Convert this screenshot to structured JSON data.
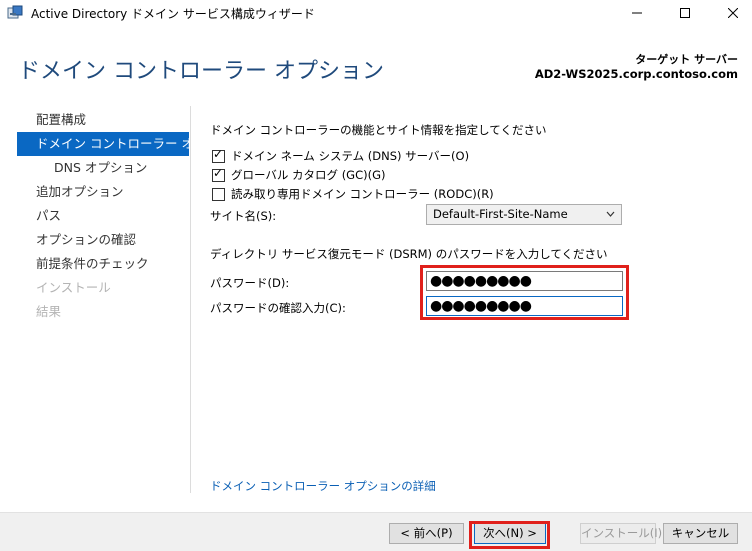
{
  "window": {
    "title": "Active Directory ドメイン サービス構成ウィザード",
    "minimize_glyph": "—",
    "maximize_glyph": "☐",
    "close_glyph": "✕"
  },
  "header": {
    "page_title": "ドメイン コントローラー オプション",
    "target_label": "ターゲット サーバー",
    "target_value": "AD2-WS2025.corp.contoso.com"
  },
  "nav": {
    "items": [
      {
        "label": "配置構成",
        "state": "normal"
      },
      {
        "label": "ドメイン コントローラー オプシ...",
        "state": "active"
      },
      {
        "label": "DNS オプション",
        "state": "sub"
      },
      {
        "label": "追加オプション",
        "state": "normal"
      },
      {
        "label": "パス",
        "state": "normal"
      },
      {
        "label": "オプションの確認",
        "state": "normal"
      },
      {
        "label": "前提条件のチェック",
        "state": "normal"
      },
      {
        "label": "インストール",
        "state": "disabled"
      },
      {
        "label": "結果",
        "state": "disabled"
      }
    ]
  },
  "main": {
    "instruction": "ドメイン コントローラーの機能とサイト情報を指定してください",
    "checkboxes": [
      {
        "label": "ドメイン ネーム システム (DNS) サーバー(O)",
        "checked": true
      },
      {
        "label": "グローバル カタログ (GC)(G)",
        "checked": true
      },
      {
        "label": "読み取り専用ドメイン コントローラー (RODC)(R)",
        "checked": false
      }
    ],
    "site_label": "サイト名(S):",
    "site_value": "Default-First-Site-Name",
    "dsrm_instruction": "ディレクトリ サービス復元モード (DSRM) のパスワードを入力してください",
    "password_label": "パスワード(D):",
    "password_value": "●●●●●●●●●",
    "confirm_label": "パスワードの確認入力(C):",
    "confirm_value": "●●●●●●●●●",
    "more_link": "ドメイン コントローラー オプションの詳細"
  },
  "footer": {
    "prev": "< 前へ(P)",
    "next": "次へ(N) >",
    "install": "インストール(I)",
    "cancel": "キャンセル"
  },
  "colors": {
    "accent": "#0a68c3",
    "title": "#1f4a7c",
    "highlight": "#e0201b"
  }
}
